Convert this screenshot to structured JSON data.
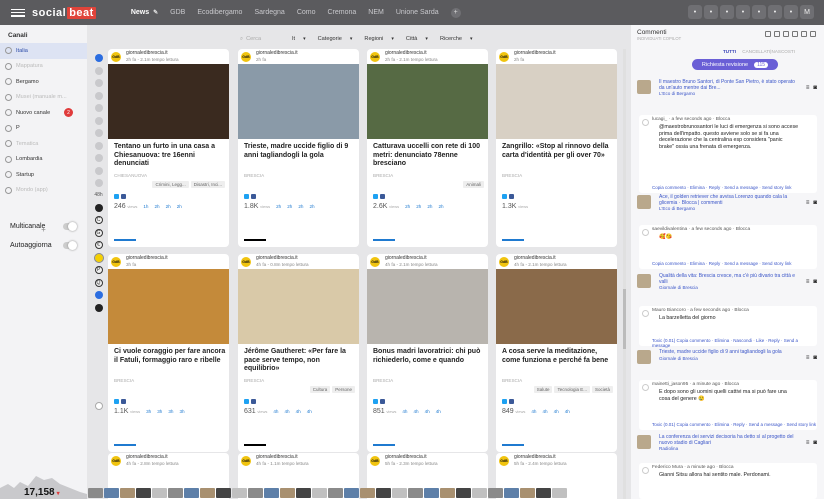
{
  "app": {
    "logo_left": "social",
    "logo_right": "beat"
  },
  "tabs": [
    {
      "label": "News",
      "active": true
    },
    {
      "label": "GDB"
    },
    {
      "label": "Ecodibergamo"
    },
    {
      "label": "Sardegna"
    },
    {
      "label": "Como"
    },
    {
      "label": "Cremona"
    },
    {
      "label": "NEM"
    },
    {
      "label": "Unione Sarda"
    }
  ],
  "topbar_icons": [
    "chat-icon",
    "grid-icon",
    "mail-icon",
    "clock-icon",
    "check-icon",
    "cloud-icon",
    "user-icon"
  ],
  "topbar_avatar": "M",
  "sidebar": {
    "title": "Canali",
    "channels": [
      {
        "label": "Italia",
        "selected": true
      },
      {
        "label": "Mappatura",
        "dim": true
      },
      {
        "label": "Bergamo"
      },
      {
        "label": "Musei (manuale m...",
        "dim": true
      },
      {
        "label": "Nuovo canale",
        "badge": "2"
      },
      {
        "label": "P"
      },
      {
        "label": "Tematica",
        "dim": true
      },
      {
        "label": "Lombardia"
      },
      {
        "label": "Startup"
      },
      {
        "label": "Mondo (app)",
        "dim": true
      }
    ],
    "multicanale": "Multicanale",
    "autoaggiorna": "Autoaggiorna",
    "counter": "17,158",
    "counter_trend": "▾"
  },
  "filters": {
    "search_placeholder": "Cerca",
    "it": "It",
    "categorie": "Categorie",
    "regioni": "Regioni",
    "citta": "Città",
    "ricerche": "Ricerche"
  },
  "left_rail": {
    "time_label": "48h"
  },
  "cards": [
    {
      "source": "giornaledibrescia.it",
      "sub": "2h fa - 2.1m tempo lettura",
      "title": "Tentano un furto in una casa a Chiesanuova: tre 16enni denunciati",
      "pub": "CHIESANUOVA",
      "tags": [
        "Crimini, Legg...",
        "Disastri, Inci..."
      ],
      "stat": "246",
      "stat_unit": "views",
      "c1": "1h",
      "c2": "2h",
      "c3": "2h",
      "c4": "2h",
      "img": "#3a2a1f"
    },
    {
      "source": "giornaledibrescia.it",
      "sub": "2h fa",
      "title": "Trieste, madre uccide figlio di 9 anni tagliandogli la gola",
      "pub": "BRESCIA",
      "tags": [],
      "stat": "1.8K",
      "stat_unit": "views",
      "c1": "2h",
      "c2": "2h",
      "c3": "2h",
      "c4": "2h",
      "img": "#8a9aa8"
    },
    {
      "source": "giornaledibrescia.it",
      "sub": "2h fa - 2.1m tempo lettura",
      "title": "Catturava uccelli con rete di 100 metri: denunciato 78enne bresciano",
      "pub": "BRESCIA",
      "tags": [
        "Animali"
      ],
      "stat": "2.6K",
      "stat_unit": "views",
      "c1": "2h",
      "c2": "2h",
      "c3": "2h",
      "c4": "2h",
      "img": "#566a44"
    },
    {
      "source": "giornaledibrescia.it",
      "sub": "2h fa",
      "title": "Zangrillo: «Stop al rinnovo della carta d'identità per gli over 70»",
      "pub": "BRESCIA",
      "tags": [],
      "stat": "1.3K",
      "stat_unit": "views",
      "c1": "",
      "c2": "",
      "c3": "",
      "c4": "",
      "img": "#d8d0c4"
    },
    {
      "source": "giornaledibrescia.it",
      "sub": "3h fa",
      "title": "Ci vuole coraggio per fare ancora il Fatuli, formaggio raro e ribelle",
      "pub": "BRESCIA",
      "tags": [],
      "stat": "1.1K",
      "stat_unit": "views",
      "c1": "3h",
      "c2": "3h",
      "c3": "3h",
      "c4": "3h",
      "img": "#c48a3a"
    },
    {
      "source": "giornaledibrescia.it",
      "sub": "4h fa - 0.8m tempo lettura",
      "title": "Jérôme Gautheret: «Per fare la pace serve tempo, non equilibrio»",
      "pub": "BRESCIA",
      "tags": [
        "Cultura",
        "Persone"
      ],
      "stat": "631",
      "stat_unit": "views",
      "c1": "4h",
      "c2": "4h",
      "c3": "4h",
      "c4": "4h",
      "img": "#d9c9a8"
    },
    {
      "source": "giornaledibrescia.it",
      "sub": "4h fa - 2.1m tempo lettura",
      "title": "Bonus madri lavoratrici: chi può richiederlo, come e quando",
      "pub": "BRESCIA",
      "tags": [],
      "stat": "851",
      "stat_unit": "views",
      "c1": "4h",
      "c2": "4h",
      "c3": "4h",
      "c4": "4h",
      "img": "#b8b4ae"
    },
    {
      "source": "giornaledibrescia.it",
      "sub": "4h fa - 2.1m tempo lettura",
      "title": "A cosa serve la meditazione, come funziona e perché fa bene",
      "pub": "BRESCIA",
      "tags": [
        "Salute",
        "Tecnologia E...",
        "Società"
      ],
      "stat": "849",
      "stat_unit": "views",
      "c1": "4h",
      "c2": "4h",
      "c3": "4h",
      "c4": "4h",
      "img": "#8a6a4a"
    },
    {
      "source": "giornaledibrescia.it",
      "sub": "4h fa - 2.8m tempo lettura",
      "title": "",
      "pub": "",
      "tags": [],
      "stat": "",
      "stat_unit": "",
      "c1": "",
      "c2": "",
      "c3": "",
      "c4": "",
      "img": "#fff"
    },
    {
      "source": "giornaledibrescia.it",
      "sub": "4h fa - 1.1m tempo lettura",
      "title": "",
      "pub": "",
      "tags": [],
      "stat": "",
      "stat_unit": "",
      "c1": "",
      "c2": "",
      "c3": "",
      "c4": "",
      "img": "#fff"
    },
    {
      "source": "giornaledibrescia.it",
      "sub": "5h fa - 2.3m tempo lettura",
      "title": "",
      "pub": "",
      "tags": [],
      "stat": "",
      "stat_unit": "",
      "c1": "",
      "c2": "",
      "c3": "",
      "c4": "",
      "img": "#fff"
    },
    {
      "source": "giornaledibrescia.it",
      "sub": "5h fa - 2.4m tempo lettura",
      "title": "",
      "pub": "",
      "tags": [],
      "stat": "",
      "stat_unit": "",
      "c1": "",
      "c2": "",
      "c3": "",
      "c4": "",
      "img": "#fff"
    }
  ],
  "right": {
    "title": "Commenti",
    "subtitle": "INDIVIDUATI COPILOT",
    "tab_all": "TUTTI",
    "tab_cancel": "CANCELLATI",
    "tab_hidden": "NASCOSTI",
    "pill_label": "Richiesta revisione",
    "pill_count": "115",
    "items": [
      {
        "kind": "post",
        "text": "Il maestro Bruno Santori, di Ponte San Pietro, è stato operato da un'auto mentre dai Bre...",
        "src": "L'Eco di Bergamo"
      },
      {
        "kind": "comment",
        "who": "lucagi_ · a few seconds ago · Blocca",
        "body": "@maestrobrunosantori le luci di emergenza si sono accese prima dell'impatto. questo avviene solo se si fa una decelerazione che la centralina esp considera \"panic brake\" ossia una frenata di emergenza.",
        "foot": "Copia commento · Elimina · Reply · Send a message · Send story link"
      },
      {
        "kind": "post",
        "text": "Ace, il golden retriever che avvisa Lorenzo quando cala la glicemia · Blocca | commenti",
        "src": "L'Eco di Bergamo"
      },
      {
        "kind": "comment",
        "who": "saevildivalentina · a few seconds ago · Blocca",
        "body": "🥰😘",
        "foot": "Copia commento · Elimina · Reply · Send a message · Send story link"
      },
      {
        "kind": "post",
        "text": "Qualità della vita: Brescia cresce, ma c'è più divario tra città e valli",
        "src": "Giornale di Brescia"
      },
      {
        "kind": "comment",
        "who": "Mauro Biancoro · a few seconds ago · Blocca",
        "body": "La barzelletta del giorno",
        "foot": "Toxic (0.01) Copia commento · Elimina · Nascondi · Like · Reply · Send a message"
      },
      {
        "kind": "post",
        "text": "Trieste, madre uccide figlio di 9 anni tagliandogli la gola",
        "src": "Giornale di Brescia"
      },
      {
        "kind": "comment",
        "who": "mainetti_jason95 · a minute ago · Blocca",
        "body": "E dopo sono gli uomini quelli cattivi ma si può fare una cosa del genere 😢",
        "foot": "Toxic (0.01) Copia commento · Elimina · Reply · Send a message · Send story link"
      },
      {
        "kind": "post",
        "text": "La conferenza dei servizi decisoria ha detto sì al progetto del nuovo stadio di Cagliari",
        "src": "Radiolina"
      },
      {
        "kind": "comment",
        "who": "Federico Mura · a minute ago · Blocca",
        "body": "Gianni Sitsu allora hai sentito male. Perdonami.",
        "foot": ""
      }
    ]
  },
  "colors": {
    "accent": "#6a5fd6",
    "brand": "#e0443a",
    "topbar": "#5b5b5e",
    "gdb_yellow": "#f1c40f",
    "twitter": "#1da1f2",
    "facebook": "#3b5998"
  }
}
